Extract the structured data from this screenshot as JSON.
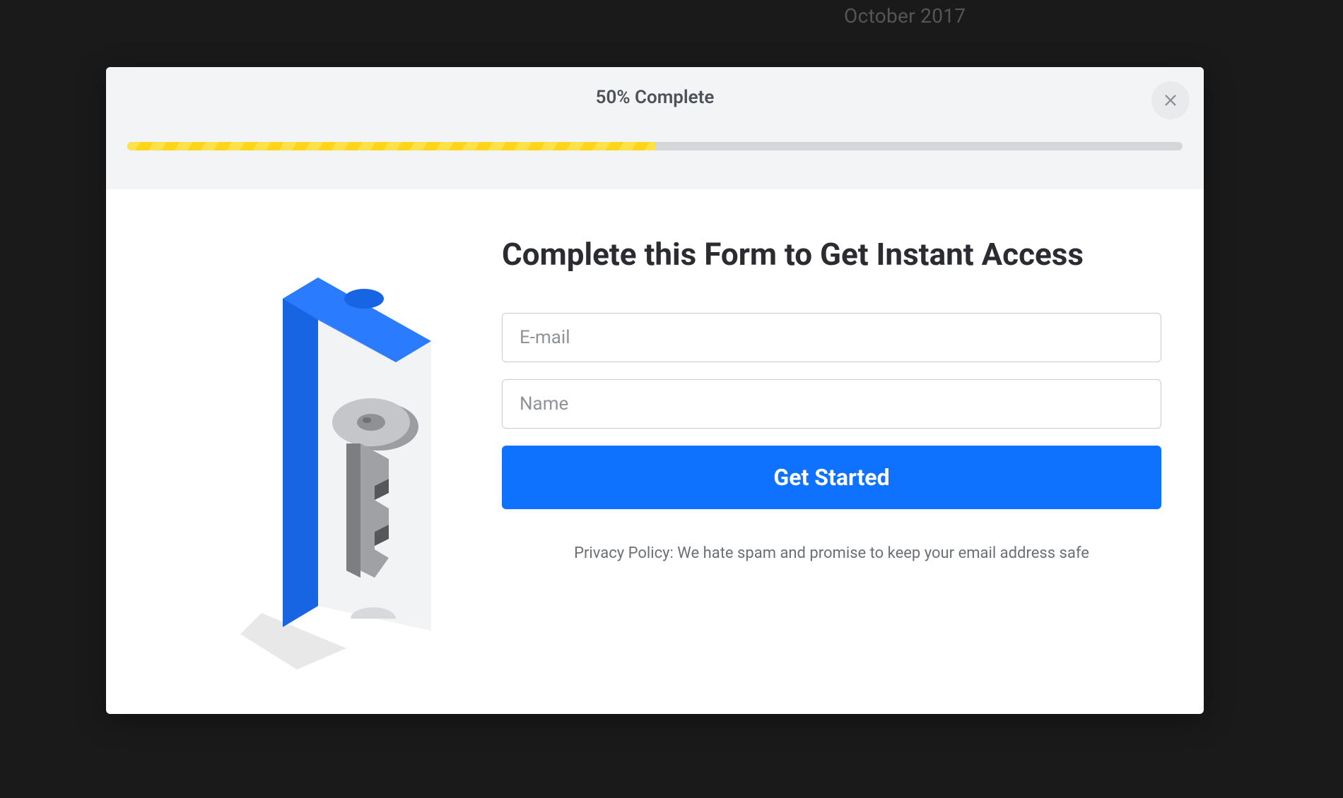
{
  "background": {
    "visible_text": "October 2017"
  },
  "modal": {
    "progress": {
      "label": "50% Complete",
      "percent": 50
    },
    "close_icon": "close-icon",
    "title": "Complete this Form to Get Instant Access",
    "fields": {
      "email_placeholder": "E-mail",
      "name_placeholder": "Name"
    },
    "submit_label": "Get Started",
    "privacy_text": "Privacy Policy: We hate spam and promise to keep your email address safe",
    "illustration": "key-ticket-icon"
  },
  "colors": {
    "accent": "#0f72ff",
    "progress_fill": "#ffd51a",
    "modal_header_bg": "#f2f4f6"
  }
}
